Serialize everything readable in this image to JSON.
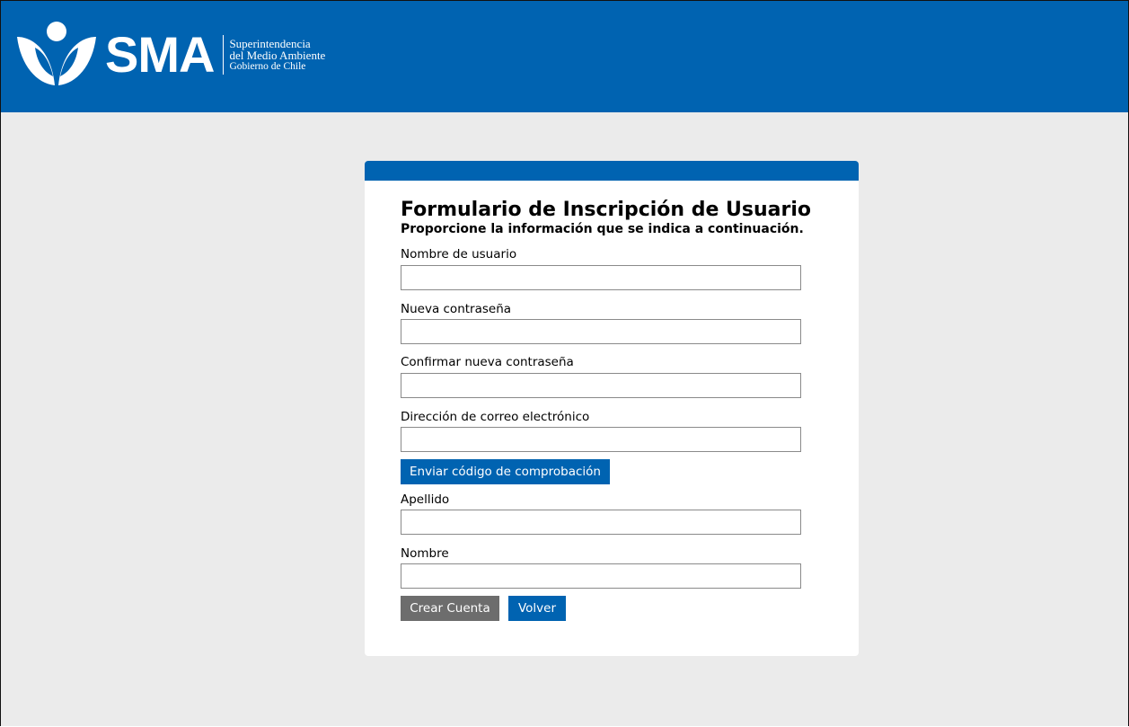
{
  "header": {
    "brand": "SMA",
    "subtitle_line1": "Superintendencia",
    "subtitle_line2": "del Medio Ambiente",
    "subtitle_line3": "Gobierno de Chile",
    "logo_icon": "sma-logo-icon",
    "color": "#0063b1"
  },
  "form": {
    "title": "Formulario de Inscripción de Usuario",
    "intro": "Proporcione la información que se indica a continuación.",
    "fields": {
      "username": {
        "label": "Nombre de usuario",
        "value": "",
        "placeholder": ""
      },
      "new_password": {
        "label": "Nueva contraseña",
        "value": "",
        "placeholder": ""
      },
      "confirm_password": {
        "label": "Confirmar nueva contraseña",
        "value": "",
        "placeholder": ""
      },
      "email": {
        "label": "Dirección de correo electrónico",
        "value": "",
        "placeholder": ""
      },
      "last_name": {
        "label": "Apellido",
        "value": "",
        "placeholder": ""
      },
      "first_name": {
        "label": "Nombre",
        "value": "",
        "placeholder": ""
      }
    },
    "send_code_label": "Enviar código de comprobación",
    "create_account_label": "Crear Cuenta",
    "back_label": "Volver"
  },
  "colors": {
    "accent": "#0063b1",
    "disabled_button": "#6d6d6d",
    "background": "#ebebeb"
  }
}
